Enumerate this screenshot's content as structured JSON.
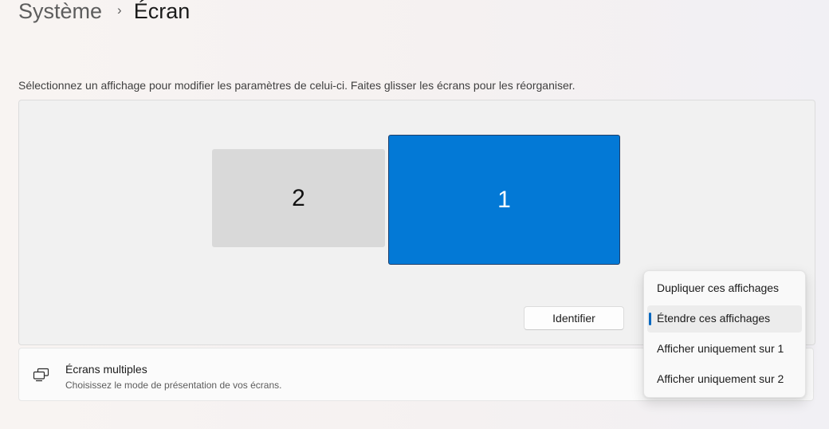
{
  "breadcrumb": {
    "parent": "Système",
    "separator": "›",
    "current": "Écran"
  },
  "instructions": "Sélectionnez un affichage pour modifier les paramètres de celui-ci. Faites glisser les écrans pour les réorganiser.",
  "displays": [
    {
      "number": "2",
      "selected": false
    },
    {
      "number": "1",
      "selected": true
    }
  ],
  "identify_button": "Identifier",
  "multiple_displays": {
    "icon": "multiple-displays-icon",
    "title": "Écrans multiples",
    "description": "Choisissez le mode de présentation de vos écrans."
  },
  "projection_menu": {
    "items": [
      {
        "label": "Dupliquer ces affichages",
        "selected": false
      },
      {
        "label": "Étendre ces affichages",
        "selected": true
      },
      {
        "label": "Afficher uniquement sur 1",
        "selected": false
      },
      {
        "label": "Afficher uniquement sur 2",
        "selected": false
      }
    ]
  },
  "colors": {
    "accent": "#0067c0",
    "selected_display": "#0379d6",
    "unselected_display": "#d9d9d9"
  }
}
